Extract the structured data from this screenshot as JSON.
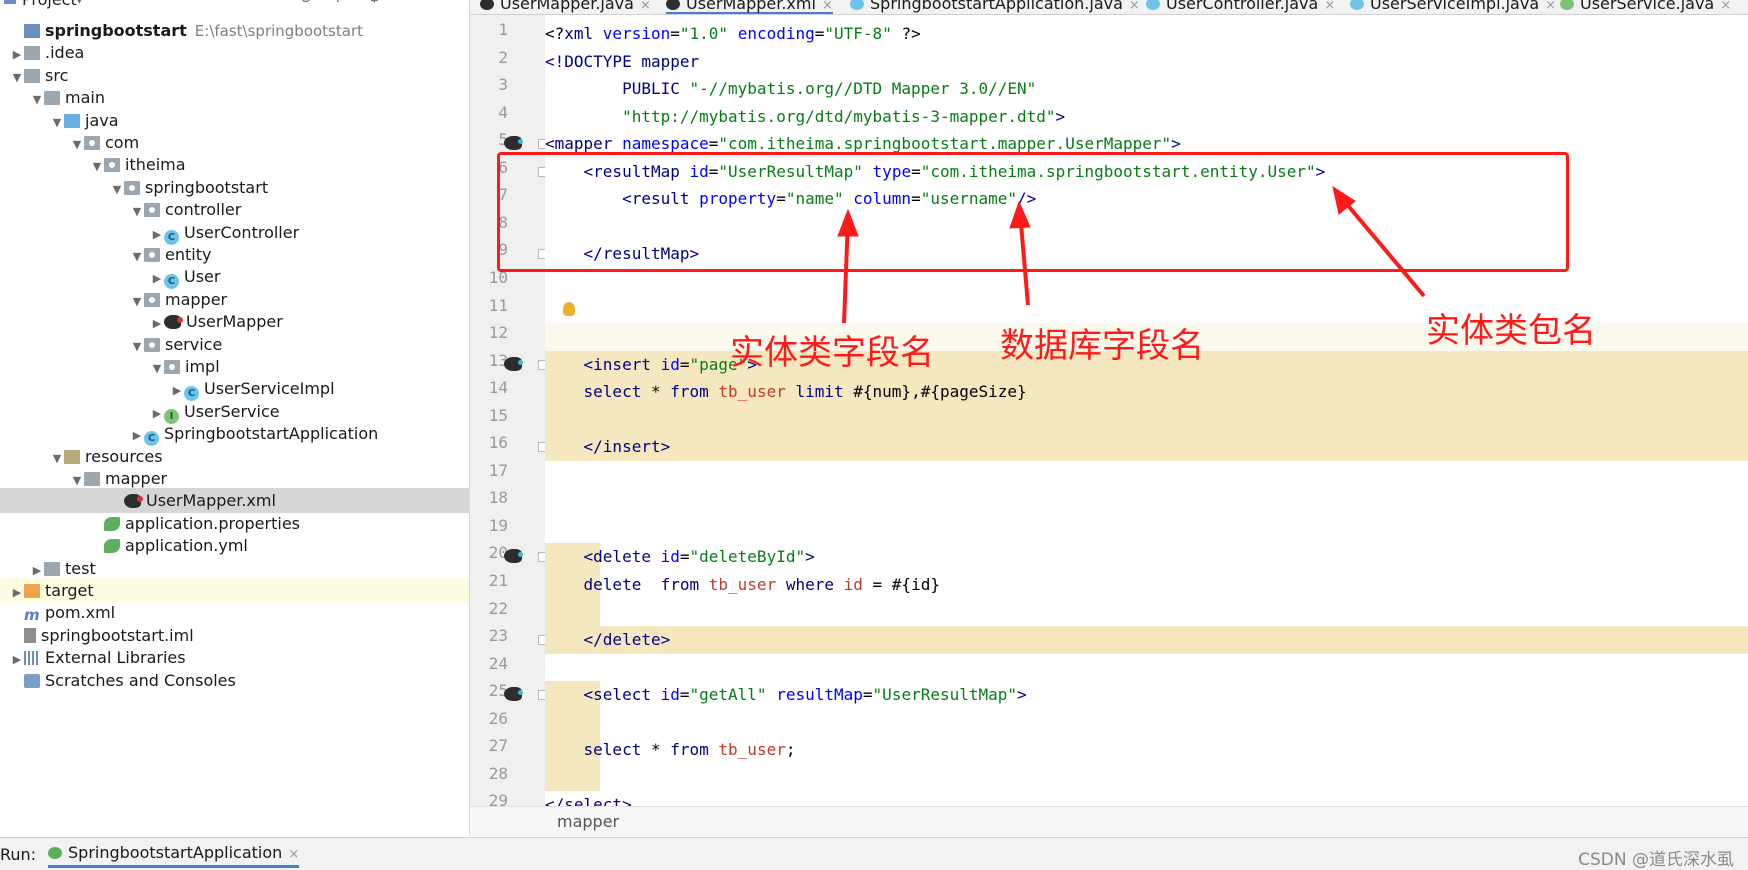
{
  "project_panel": {
    "title": "Project",
    "tree": [
      {
        "label": "springbootstart",
        "extra": "E:\\fast\\springbootstart",
        "icon": "project-icon",
        "depth": 0,
        "arrow": "",
        "bold": true
      },
      {
        "label": ".idea",
        "icon": "folder-icon",
        "depth": 0,
        "arrow": "▶"
      },
      {
        "label": "src",
        "icon": "folder-icon",
        "depth": 0,
        "arrow": "▼"
      },
      {
        "label": "main",
        "icon": "folder-icon",
        "depth": 1,
        "arrow": "▼"
      },
      {
        "label": "java",
        "icon": "source-folder-icon",
        "depth": 2,
        "arrow": "▼"
      },
      {
        "label": "com",
        "icon": "package-icon",
        "depth": 3,
        "arrow": "▼"
      },
      {
        "label": "itheima",
        "icon": "package-icon",
        "depth": 4,
        "arrow": "▼"
      },
      {
        "label": "springbootstart",
        "icon": "package-icon",
        "depth": 5,
        "arrow": "▼"
      },
      {
        "label": "controller",
        "icon": "package-icon",
        "depth": 6,
        "arrow": "▼"
      },
      {
        "label": "UserController",
        "icon": "class-icon",
        "depth": 7,
        "arrow": "▶"
      },
      {
        "label": "entity",
        "icon": "package-icon",
        "depth": 6,
        "arrow": "▼"
      },
      {
        "label": "User",
        "icon": "class-icon",
        "depth": 7,
        "arrow": "▶"
      },
      {
        "label": "mapper",
        "icon": "package-icon",
        "depth": 6,
        "arrow": "▼"
      },
      {
        "label": "UserMapper",
        "icon": "mybatis-icon",
        "depth": 7,
        "arrow": "▶"
      },
      {
        "label": "service",
        "icon": "package-icon",
        "depth": 6,
        "arrow": "▼"
      },
      {
        "label": "impl",
        "icon": "package-icon",
        "depth": 7,
        "arrow": "▼"
      },
      {
        "label": "UserServiceImpl",
        "icon": "class-icon",
        "depth": 8,
        "arrow": "▶"
      },
      {
        "label": "UserService",
        "icon": "interface-icon",
        "depth": 7,
        "arrow": "▶"
      },
      {
        "label": "SpringbootstartApplication",
        "icon": "spring-class-icon",
        "depth": 6,
        "arrow": "▶"
      },
      {
        "label": "resources",
        "icon": "resources-folder-icon",
        "depth": 2,
        "arrow": "▼"
      },
      {
        "label": "mapper",
        "icon": "folder-icon",
        "depth": 3,
        "arrow": "▼"
      },
      {
        "label": "UserMapper.xml",
        "icon": "mybatis-icon",
        "depth": 5,
        "arrow": "",
        "selected": true
      },
      {
        "label": "application.properties",
        "icon": "spring-leaf-icon",
        "depth": 4,
        "arrow": ""
      },
      {
        "label": "application.yml",
        "icon": "spring-leaf-icon",
        "depth": 4,
        "arrow": ""
      },
      {
        "label": "test",
        "icon": "folder-icon",
        "depth": 1,
        "arrow": "▶"
      },
      {
        "label": "target",
        "icon": "excluded-folder-icon",
        "depth": 0,
        "arrow": "▶",
        "highlight": true
      },
      {
        "label": "pom.xml",
        "icon": "maven-icon",
        "depth": 0,
        "arrow": ""
      },
      {
        "label": "springbootstart.iml",
        "icon": "iml-file-icon",
        "depth": 0,
        "arrow": ""
      },
      {
        "label": "External Libraries",
        "icon": "libraries-icon",
        "depth": -1,
        "arrow": "▶"
      },
      {
        "label": "Scratches and Consoles",
        "icon": "scratches-icon",
        "depth": -1,
        "arrow": ""
      }
    ]
  },
  "tabs": [
    {
      "label": "UserMapper.java",
      "icon": "mybatis-icon"
    },
    {
      "label": "UserMapper.xml",
      "icon": "mybatis-icon",
      "active": true
    },
    {
      "label": "SpringbootstartApplication.java",
      "icon": "spring-class-icon"
    },
    {
      "label": "UserController.java",
      "icon": "class-icon"
    },
    {
      "label": "UserServiceImpl.java",
      "icon": "class-icon"
    },
    {
      "label": "UserService.java",
      "icon": "interface-icon"
    }
  ],
  "editor": {
    "line_numbers": [
      "1",
      "2",
      "3",
      "4",
      "5",
      "6",
      "7",
      "8",
      "9",
      "10",
      "11",
      "12",
      "13",
      "14",
      "15",
      "16",
      "17",
      "18",
      "19",
      "20",
      "21",
      "22",
      "23",
      "24",
      "25",
      "26",
      "27",
      "28",
      "29"
    ],
    "lines": [
      [
        [
          "p",
          "<?"
        ],
        [
          "t",
          "xml "
        ],
        [
          "a",
          "version"
        ],
        [
          "p",
          "="
        ],
        [
          "v",
          "\"1.0\""
        ],
        [
          "p",
          " "
        ],
        [
          "a",
          "encoding"
        ],
        [
          "p",
          "="
        ],
        [
          "v",
          "\"UTF-8\""
        ],
        [
          "p",
          " ?>"
        ]
      ],
      [
        [
          "t",
          "<!DOCTYPE mapper"
        ]
      ],
      [
        [
          "t",
          "        PUBLIC "
        ],
        [
          "v",
          "\"-//mybatis.org//DTD Mapper 3.0//EN\""
        ]
      ],
      [
        [
          "v",
          "        \"http://mybatis.org/dtd/mybatis-3-mapper.dtd\""
        ],
        [
          "t",
          ">"
        ]
      ],
      [
        [
          "t",
          "<mapper "
        ],
        [
          "a",
          "namespace"
        ],
        [
          "p",
          "="
        ],
        [
          "v",
          "\"com.itheima.springbootstart.mapper.UserMapper\""
        ],
        [
          "t",
          ">"
        ]
      ],
      [
        [
          "t",
          "    <resultMap "
        ],
        [
          "a",
          "id"
        ],
        [
          "p",
          "="
        ],
        [
          "v",
          "\"UserResultMap\""
        ],
        [
          "p",
          " "
        ],
        [
          "a",
          "type"
        ],
        [
          "p",
          "="
        ],
        [
          "v",
          "\"com.itheima.springbootstart.entity.User\""
        ],
        [
          "t",
          ">"
        ]
      ],
      [
        [
          "t",
          "        <result "
        ],
        [
          "a",
          "property"
        ],
        [
          "p",
          "="
        ],
        [
          "v",
          "\"name\""
        ],
        [
          "p",
          " "
        ],
        [
          "a",
          "column"
        ],
        [
          "p",
          "="
        ],
        [
          "v",
          "\"username\""
        ],
        [
          "t",
          "/>"
        ]
      ],
      [],
      [
        [
          "t",
          "    </resultMap>"
        ]
      ],
      [],
      [],
      [],
      [
        [
          "t",
          "    <insert "
        ],
        [
          "a",
          "id"
        ],
        [
          "p",
          "="
        ],
        [
          "v",
          "\"page\""
        ],
        [
          "t",
          ">"
        ]
      ],
      [
        [
          "k",
          "    select "
        ],
        [
          "p",
          "* "
        ],
        [
          "k",
          "from "
        ],
        [
          "tn",
          "tb_user "
        ],
        [
          "k",
          "limit "
        ],
        [
          "p",
          "#{num},#{pageSize}"
        ]
      ],
      [],
      [
        [
          "t",
          "    </insert>"
        ]
      ],
      [],
      [],
      [],
      [
        [
          "t",
          "    <delete "
        ],
        [
          "a",
          "id"
        ],
        [
          "p",
          "="
        ],
        [
          "v",
          "\"deleteById\""
        ],
        [
          "t",
          ">"
        ]
      ],
      [
        [
          "k",
          "    delete  from "
        ],
        [
          "tn",
          "tb_user "
        ],
        [
          "k",
          "where "
        ],
        [
          "tn",
          "id "
        ],
        [
          "p",
          "= #{id}"
        ]
      ],
      [],
      [
        [
          "t",
          "    </delete>"
        ]
      ],
      [],
      [
        [
          "t",
          "    <select "
        ],
        [
          "a",
          "id"
        ],
        [
          "p",
          "="
        ],
        [
          "v",
          "\"getAll\""
        ],
        [
          "p",
          " "
        ],
        [
          "a",
          "resultMap"
        ],
        [
          "p",
          "="
        ],
        [
          "v",
          "\"UserResultMap\""
        ],
        [
          "t",
          ">"
        ]
      ],
      [],
      [
        [
          "k",
          "    select "
        ],
        [
          "p",
          "* "
        ],
        [
          "k",
          "from "
        ],
        [
          "tn",
          "tb_user"
        ],
        [
          "p",
          ";"
        ]
      ],
      [],
      [
        [
          "t",
          "</select>"
        ]
      ]
    ]
  },
  "annotations": {
    "entity_field": "实体类字段名",
    "db_field": "数据库字段名",
    "entity_package": "实体类包名"
  },
  "breadcrumb": "mapper",
  "run_bar": {
    "label": "Run:",
    "tab": "SpringbootstartApplication",
    "close": "×"
  },
  "watermark": "CSDN @道氏深水虱",
  "colors": {
    "tag": "#000080",
    "attribute": "#0000ff",
    "string": "#067d17",
    "annotation_red": "#ff1a1a",
    "sql_band": "#f5e8c0"
  }
}
